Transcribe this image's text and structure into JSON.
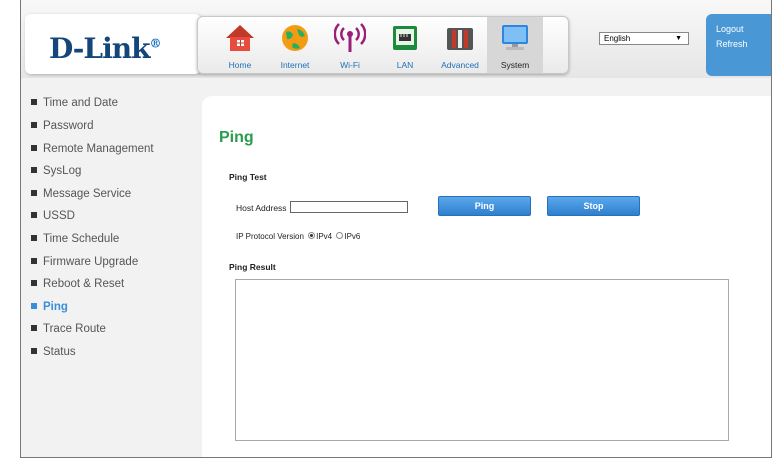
{
  "brand": {
    "logo_text": "D-Link",
    "logo_mark": "®"
  },
  "nav": {
    "items": [
      {
        "label": "Home",
        "icon": "home-icon"
      },
      {
        "label": "Internet",
        "icon": "internet-globe-icon"
      },
      {
        "label": "Wi-Fi",
        "icon": "wifi-signal-icon"
      },
      {
        "label": "LAN",
        "icon": "lan-router-icon"
      },
      {
        "label": "Advanced",
        "icon": "advanced-tools-icon"
      },
      {
        "label": "System",
        "icon": "system-monitor-icon",
        "active": true
      }
    ]
  },
  "language": {
    "selected": "English",
    "arrow": "▼"
  },
  "account": {
    "logout_label": "Logout",
    "refresh_label": "Refresh"
  },
  "sidebar": {
    "items": [
      {
        "label": "Time and Date"
      },
      {
        "label": "Password"
      },
      {
        "label": "Remote Management"
      },
      {
        "label": "SysLog"
      },
      {
        "label": "Message Service"
      },
      {
        "label": "USSD"
      },
      {
        "label": "Time Schedule"
      },
      {
        "label": "Firmware Upgrade"
      },
      {
        "label": "Reboot & Reset"
      },
      {
        "label": "Ping",
        "active": true
      },
      {
        "label": "Trace Route"
      },
      {
        "label": "Status"
      }
    ]
  },
  "main": {
    "title": "Ping",
    "ping_test": {
      "heading": "Ping Test",
      "host_label": "Host Address",
      "host_value": "",
      "ping_button": "Ping",
      "stop_button": "Stop",
      "ip_version_label": "IP Protocol Version",
      "ipv4_label": "IPv4",
      "ipv6_label": "IPv6",
      "selected_version": "IPv4"
    },
    "ping_result": {
      "heading": "Ping Result",
      "output": ""
    }
  },
  "colors": {
    "accent_blue": "#3b8fd8",
    "title_green": "#2a9b4f",
    "logo_blue": "#15467a",
    "logout_panel": "#4a97d6"
  }
}
